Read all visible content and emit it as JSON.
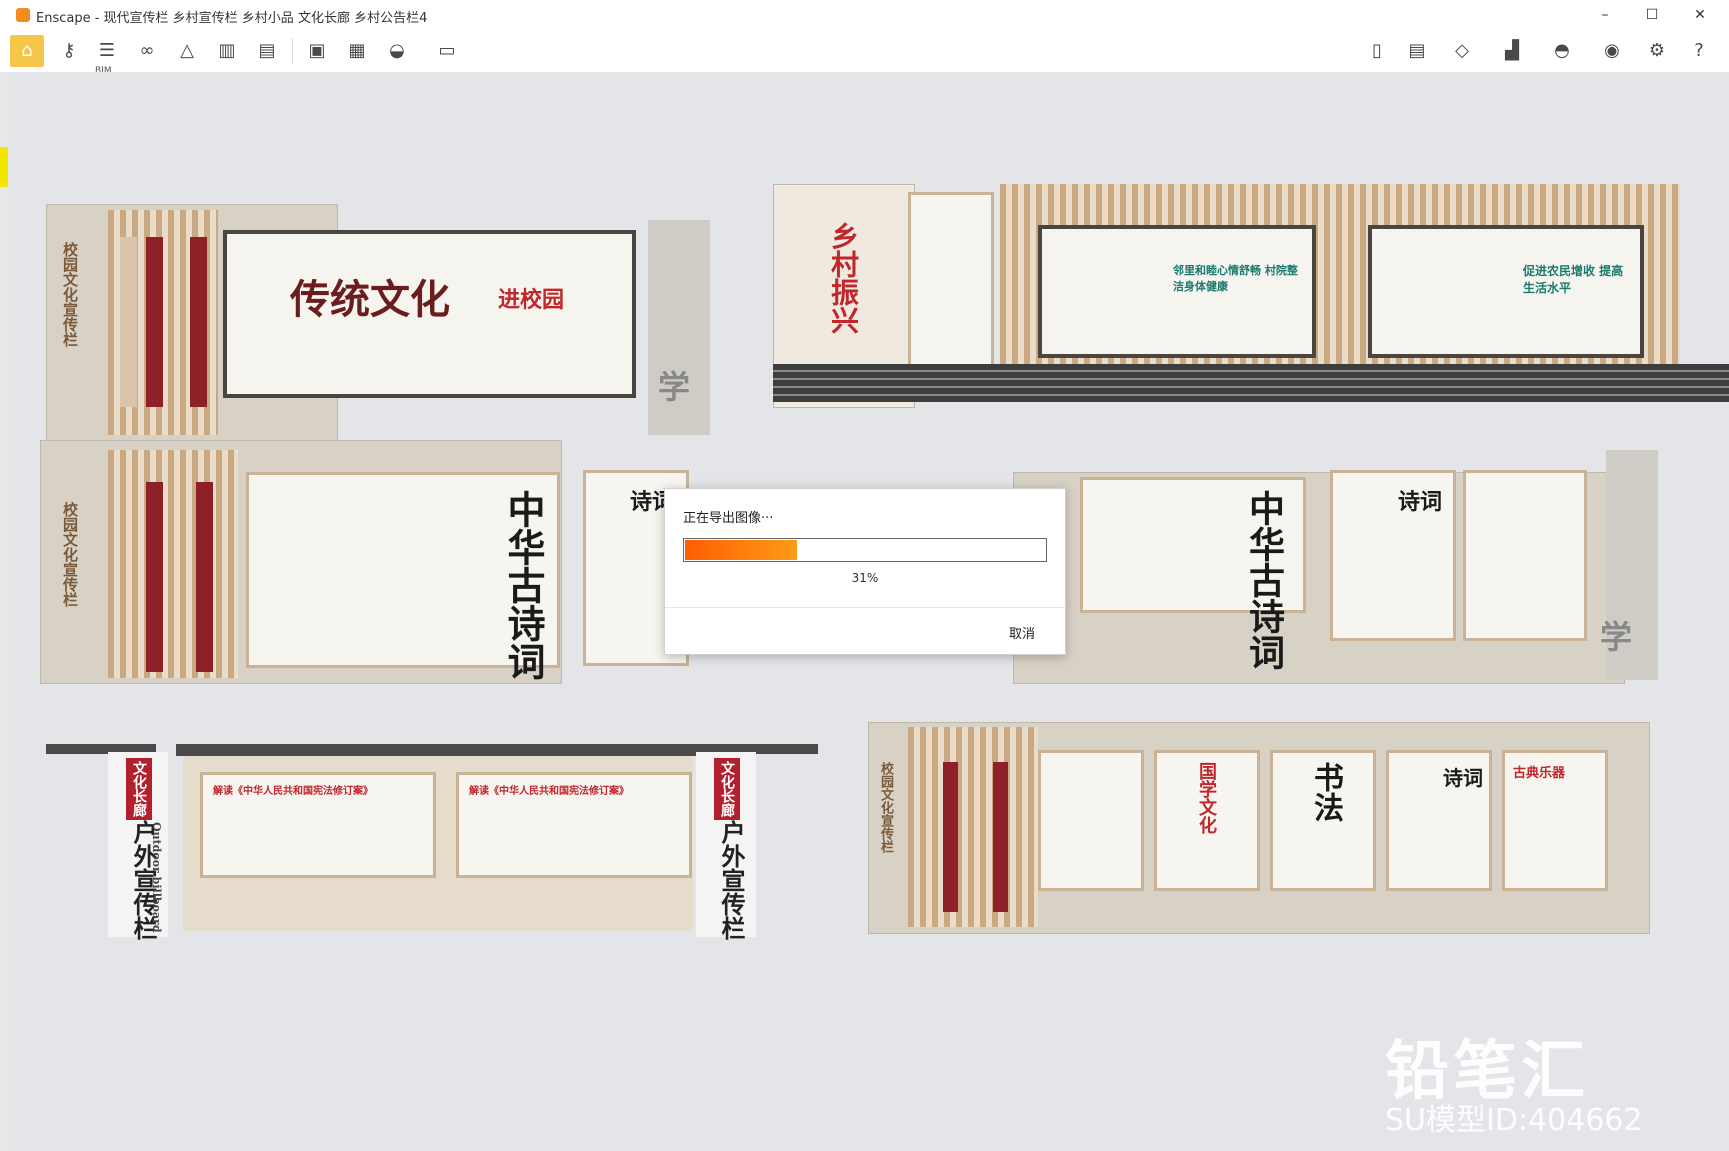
{
  "window": {
    "title": "Enscape - 现代宣传栏 乡村宣传栏 乡村小品 文化长廊 乡村公告栏4",
    "minimize": "–",
    "maximize": "☐",
    "close": "✕"
  },
  "toolbar": {
    "bim_label": "BIM",
    "icons": [
      "home-icon",
      "key-icon",
      "bim-icon",
      "binoculars-icon",
      "compass-icon",
      "buildings-icon",
      "clapper-icon",
      "screenshot-icon",
      "batch-export-icon",
      "panorama-icon",
      "exe-export-icon",
      "book-icon",
      "sheet-icon",
      "cube-icon",
      "chart-icon",
      "helmet-icon",
      "eye-icon",
      "gear-icon",
      "help-icon"
    ],
    "collapse_glyph": "⌃"
  },
  "scene": {
    "board1_title": "传统文化",
    "board1_sub": "进校园",
    "board1_vertical": "校园文化宣传栏",
    "board2_vertical": "乡村振兴",
    "board2_left_poster": "邻里和睦心情舒畅 村院整洁身体健康",
    "board2_right_poster": "促进农民增收 提高生活水平",
    "board3_title": "中华古诗词",
    "board3_vertical": "校园文化宣传栏",
    "board3_poem": "诗词",
    "board4_title": "中华古诗词",
    "board4_poem": "诗词",
    "board5_left_title": "文化长廊",
    "board5_left_sub": "户外宣传栏",
    "board5_left_en": "Outdoor billboard",
    "board5_notice": "解读《中华人民共和国宪法修订案》",
    "board5_right_title": "文化长廊",
    "board5_right_sub": "户外宣传栏",
    "board6_vertical": "校园文化宣传栏",
    "board6_p1": "国学文化",
    "board6_p2": "书法",
    "board6_p3": "诗词",
    "board6_p4": "古典乐器",
    "xue_glyph": "学"
  },
  "watermark": {
    "brand": "铅笔汇",
    "model_id": "SU模型ID:404662"
  },
  "export_dialog": {
    "title": "正在导出图像···",
    "progress_percent": 31,
    "progress_text": "31%",
    "cancel_label": "取消"
  }
}
